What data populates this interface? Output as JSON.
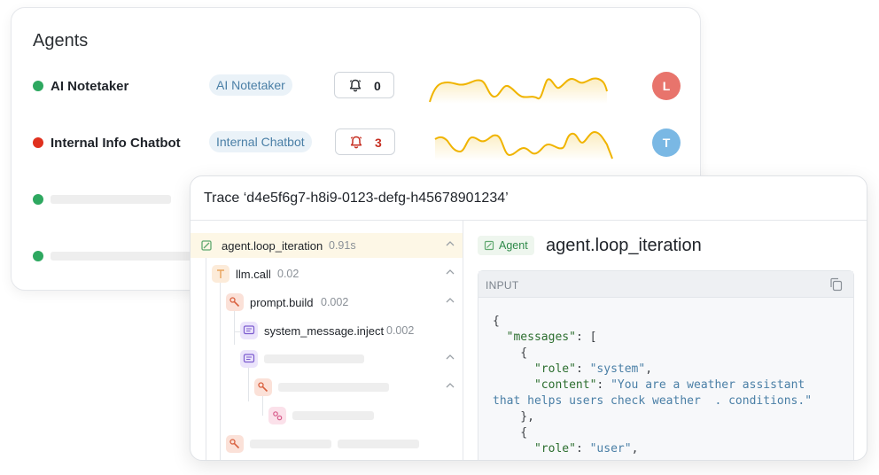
{
  "agents": {
    "title": "Agents",
    "rows": [
      {
        "name": "AI Notetaker",
        "status_color": "#2ea860",
        "tag": "AI Notetaker",
        "alert_count": "0",
        "avatar": "L",
        "avatar_color": "#e8746c"
      },
      {
        "name": "Internal Info Chatbot",
        "status_color": "#e0301e",
        "tag": "Internal Chatbot",
        "alert_count": "3",
        "avatar": "T",
        "avatar_color": "#7ab8e4"
      }
    ]
  },
  "trace": {
    "title": "Trace ‘d4e5f6g7-h8i9-0123-defg-h45678901234’",
    "tree": [
      {
        "label": "agent.loop_iteration",
        "time": "0.91s",
        "icon": "agent-icon"
      },
      {
        "label": "llm.call",
        "time": "0.02",
        "icon": "llm-icon"
      },
      {
        "label": "prompt.build",
        "time": "0.002",
        "icon": "wrench-icon"
      },
      {
        "label": "system_message.inject",
        "time": "0.002",
        "icon": "message-icon"
      }
    ],
    "detail": {
      "badge": "Agent",
      "title": "agent.loop_iteration",
      "input_label": "INPUT"
    }
  },
  "colors": {
    "accent_yellow": "#f0b400",
    "agent_green": "#2f8a4a",
    "alert_red": "#c62f22"
  }
}
